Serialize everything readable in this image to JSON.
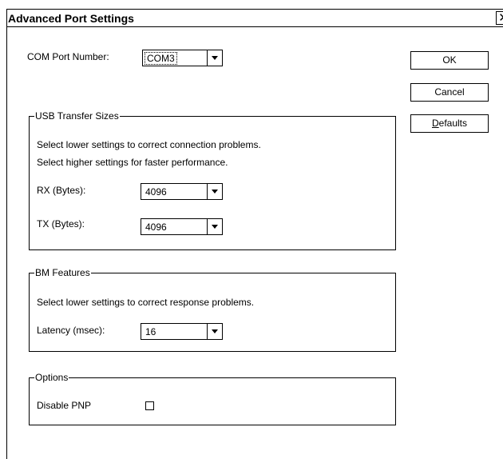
{
  "window": {
    "title": "Advanced Port Settings",
    "close_glyph": "✕"
  },
  "com_port": {
    "label": "COM Port Number:",
    "value": "COM3"
  },
  "buttons": {
    "ok": "OK",
    "cancel": "Cancel",
    "defaults": "Defaults"
  },
  "usb_group": {
    "title": "USB Transfer Sizes",
    "hint1": "Select lower settings to correct connection problems.",
    "hint2": "Select higher settings for faster performance.",
    "rx_label": "RX (Bytes):",
    "rx_value": "4096",
    "tx_label": "TX (Bytes):",
    "tx_value": "4096"
  },
  "bm_group": {
    "title": "BM Features",
    "hint": "Select lower settings to correct response problems.",
    "latency_label": "Latency (msec):",
    "latency_value": "16"
  },
  "options_group": {
    "title": "Options",
    "disable_pnp_label": "Disable PNP",
    "disable_pnp_checked": false
  },
  "icons": {
    "close": "close-icon",
    "dropdown": "chevron-down-icon"
  }
}
